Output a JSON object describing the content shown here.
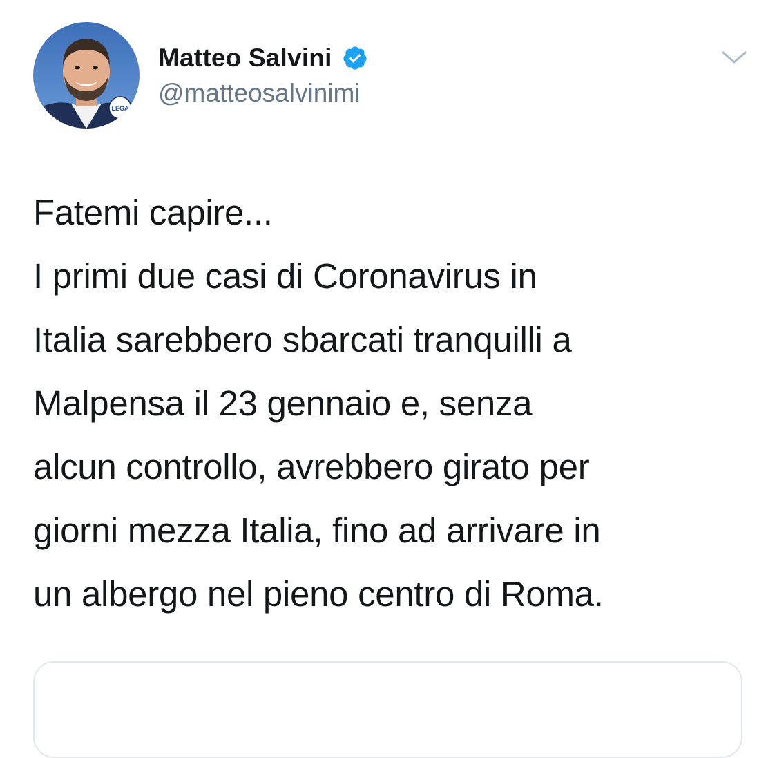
{
  "author": {
    "display_name": "Matteo Salvini",
    "handle": "@matteosalvinimi",
    "verified_icon": "verified-badge-icon",
    "avatar_icon": "profile-avatar",
    "avatar_badge_text": "LEGA"
  },
  "menu": {
    "icon": "chevron-down-icon"
  },
  "tweet": {
    "text": "Fatemi capire...\nI primi due casi di Coronavirus in\nItalia sarebbero sbarcati tranquilli a\nMalpensa il 23 gennaio e, senza\nalcun controllo, avrebbero girato per\ngiorni mezza Italia, fino ad arrivare in\nun albergo nel pieno centro di Roma."
  },
  "colors": {
    "text_primary": "#14171a",
    "text_secondary": "#657786",
    "verified_blue": "#1da1f2",
    "border": "#e1e8ed",
    "caret": "#aab8c2"
  }
}
